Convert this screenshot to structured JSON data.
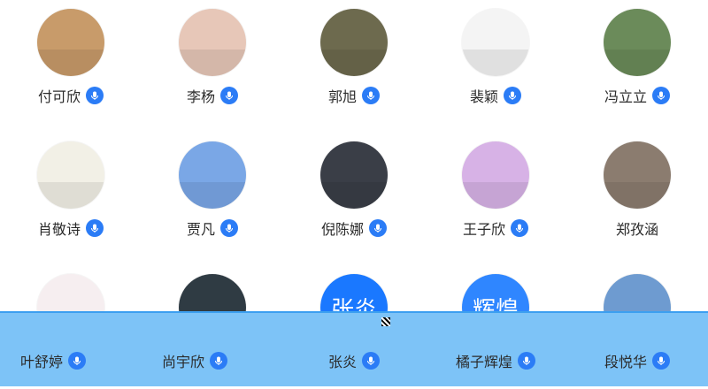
{
  "contacts": [
    {
      "name": "付可欣",
      "avatar": "photo-girl-table",
      "color": "#c89b6a"
    },
    {
      "name": "李杨",
      "avatar": "photo-child-face",
      "color": "#e7c7b8"
    },
    {
      "name": "郭旭",
      "avatar": "photo-painting",
      "color": "#6d6a4e"
    },
    {
      "name": "裴颖",
      "avatar": "sketch-drawing",
      "color": "#f4f4f4"
    },
    {
      "name": "冯立立",
      "avatar": "photo-girl-ears",
      "color": "#6b8b5a"
    },
    {
      "name": "肖敬诗",
      "avatar": "photo-man",
      "color": "#f2f0e6"
    },
    {
      "name": "贾凡",
      "avatar": "cartoon-duck",
      "color": "#7aa7e6"
    },
    {
      "name": "倪陈娜",
      "avatar": "photo-night-street",
      "color": "#3a3e47"
    },
    {
      "name": "王子欣",
      "avatar": "cartoon-hood",
      "color": "#d7b2e6"
    },
    {
      "name": "郑孜涵",
      "avatar": "photo-boy-cap",
      "color": "#8b7c6f"
    },
    {
      "name": "叶舒婷",
      "avatar": "illustration-woman",
      "color": "#f6eef0"
    },
    {
      "name": "尚宇欣",
      "avatar": "photo-masked-person",
      "color": "#2f3b43"
    },
    {
      "name": "张炎",
      "avatar_text": "张炎",
      "avatar": "text-avatar",
      "color": "#1a78ff"
    },
    {
      "name": "橘子辉煌",
      "avatar_text": "辉煌",
      "avatar": "text-avatar",
      "color": "#2f86ff"
    },
    {
      "name": "段悦华",
      "avatar": "photo-ribbon-hair",
      "color": "#6e9bd0"
    }
  ],
  "badge_color": "#2b7cf6",
  "bottom_bar_color": "#7dc3f7"
}
